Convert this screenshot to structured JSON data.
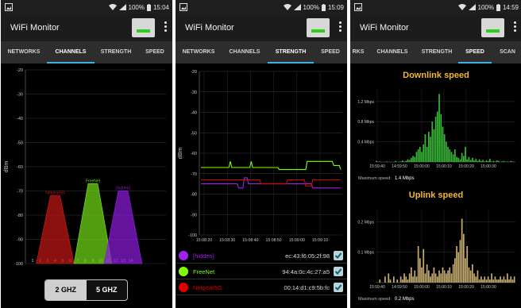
{
  "app": {
    "title": "WiFi Monitor"
  },
  "screens": [
    {
      "status_battery": "100%",
      "status_time": "15:04",
      "tabs": [
        "NETWORKS",
        "CHANNELS",
        "STRENGTH",
        "SPEED"
      ],
      "active_tab": "CHANNELS",
      "band_toggle": {
        "left": "2 GHZ",
        "right": "5 GHZ",
        "selected": "2 GHZ"
      }
    },
    {
      "status_battery": "100%",
      "status_time": "15:09",
      "tabs": [
        "NETWORKS",
        "CHANNELS",
        "STRENGTH",
        "SPEED"
      ],
      "active_tab": "STRENGTH",
      "networks": [
        {
          "ssid": "[hidden]",
          "mac": "ec:43:f6:05:2f:98",
          "color": "#a020f0",
          "checked": true
        },
        {
          "ssid": "FreeNet",
          "mac": "94:4a:0c:4c:27:a5",
          "color": "#7fff00",
          "checked": true
        },
        {
          "ssid": "Netgear5G",
          "mac": "00:14:d1:c9:5b:fc",
          "color": "#e00000",
          "checked": true
        }
      ]
    },
    {
      "status_battery": "100%",
      "status_time": "14:59",
      "tabs": [
        "RKS",
        "CHANNELS",
        "STRENGTH",
        "SPEED",
        "SCAN"
      ],
      "active_tab": "SPEED",
      "downlink": {
        "title": "Downlink speed",
        "max_label": "Maximum speed:",
        "max_value": "1.4 Mbps"
      },
      "uplink": {
        "title": "Uplink speed",
        "max_label": "Maximum speed:",
        "max_value": "0.2 Mbps"
      }
    }
  ],
  "chart_data": [
    {
      "type": "area",
      "chart": "channels",
      "ylabel": "dBm",
      "ylim": [
        -100,
        -20
      ],
      "yticks": [
        -20,
        -30,
        -40,
        -50,
        -60,
        -70,
        -80,
        -90,
        -100
      ],
      "xticks": [
        1,
        2,
        3,
        4,
        5,
        6,
        7,
        8,
        9,
        10,
        11,
        12,
        13,
        14
      ],
      "grid": true,
      "series": [
        {
          "name": "Netgear5G",
          "channel": 4,
          "level": -72,
          "color": "#c01818"
        },
        {
          "name": "FreeNet",
          "channel": 9,
          "level": -67,
          "color": "#70d818"
        },
        {
          "name": "[hidden]",
          "channel": 13,
          "level": -70,
          "color": "#8a1ad8"
        }
      ]
    },
    {
      "type": "line",
      "chart": "strength",
      "ylabel": "dBm",
      "ylim": [
        -100,
        -20
      ],
      "yticks": [
        -20,
        -30,
        -40,
        -50,
        -60,
        -70,
        -80,
        -90,
        -100
      ],
      "xtick_labels": [
        "15:08:20",
        "15:08:30",
        "15:08:40",
        "15:08:50",
        "15:09:00",
        "15:09:10"
      ],
      "grid": true,
      "series": [
        {
          "name": "FreeNet",
          "color": "#7fff00",
          "values": [
            -67,
            -67,
            -67,
            -67,
            -67,
            -67,
            -67,
            -67,
            -67,
            -67,
            -67,
            -67,
            -67,
            -67,
            -67,
            -67,
            -67,
            -67,
            -67,
            -67,
            -67,
            -64,
            -67,
            -67,
            -67,
            -67,
            -67,
            -67,
            -67,
            -67,
            -67,
            -67,
            -67,
            -67,
            -67,
            -67,
            -64,
            -67,
            -67,
            -67,
            -67,
            -67,
            -67,
            -67,
            -67,
            -67,
            -67,
            -67,
            -67,
            -67,
            -67,
            -67,
            -67,
            -67,
            -67,
            -67,
            -68,
            -68,
            -68,
            -68,
            -68,
            -68,
            -68,
            -68,
            -68,
            -68,
            -68,
            -68,
            -68,
            -68,
            -68,
            -68,
            -68,
            -68,
            -68,
            -68,
            -64,
            -64,
            -64,
            -64,
            -64,
            -64,
            -64,
            -64,
            -64,
            -64,
            -64,
            -64,
            -64,
            -64,
            -64,
            -64,
            -64,
            -64,
            -64,
            -66,
            -66,
            -66,
            -66,
            -66,
            -68
          ]
        },
        {
          "name": "[hidden]",
          "color": "#a020f0",
          "values": [
            -75,
            -75,
            -75,
            -75,
            -75,
            -75,
            -75,
            -75,
            -75,
            -75,
            -75,
            -75,
            -75,
            -75,
            -75,
            -75,
            -75,
            -75,
            -75,
            -75,
            -75,
            -75,
            -75,
            -75,
            -75,
            -75,
            -75,
            -77,
            -77,
            -77,
            -77,
            -72,
            -72,
            -72,
            -75,
            -75,
            -75,
            -75,
            -75,
            -75,
            -75,
            -75,
            -75,
            -75,
            -75,
            -75,
            -75,
            -75,
            -75,
            -75,
            -75,
            -75,
            -75,
            -75,
            -75,
            -75,
            -75,
            -75,
            -75,
            -75,
            -75,
            -75,
            -75,
            -75,
            -75,
            -75,
            -75,
            -75,
            -75,
            -75,
            -75,
            -75,
            -75,
            -75,
            -75,
            -75,
            -75,
            -75,
            -75,
            -75,
            -77,
            -77,
            -77,
            -77,
            -77,
            -77,
            -77,
            -77,
            -77,
            -77,
            -77,
            -77,
            -77,
            -77,
            -77,
            -77,
            -77,
            -77,
            -77,
            -77,
            -77
          ]
        },
        {
          "name": "Netgear5G",
          "color": "#e00000",
          "values": [
            -73,
            -73,
            -73,
            -73,
            -73,
            -73,
            -73,
            -73,
            -73,
            -73,
            -73,
            -73,
            -73,
            -73,
            -73,
            -73,
            -73,
            -73,
            -73,
            -73,
            -73,
            -73,
            -73,
            -73,
            -73,
            -73,
            -73,
            -73,
            -73,
            -73,
            -73,
            -73,
            -73,
            -73,
            -73,
            -73,
            -73,
            -73,
            -73,
            -73,
            -73,
            -73,
            -73,
            -75,
            -75,
            -75,
            -75,
            -75,
            -75,
            -75,
            -75,
            -75,
            -75,
            -75,
            -75,
            -75,
            -75,
            -75,
            -75,
            -75,
            -75,
            -75,
            -73,
            -73,
            -73,
            -73,
            -73,
            -73,
            -73,
            -73,
            -73,
            -73,
            -73,
            -73,
            -73,
            -76,
            -76,
            -76,
            -76,
            -76,
            -73,
            -73,
            -73,
            -73,
            -73,
            -73,
            -73,
            -73,
            -73,
            -73,
            -73,
            -73,
            -73,
            -73,
            -73,
            -73,
            -73,
            -73,
            -73,
            -73,
            -73
          ]
        }
      ]
    },
    {
      "type": "bar",
      "chart": "downlink",
      "title": "Downlink speed",
      "yticks": [
        0.4,
        0.8,
        1.2
      ],
      "ytick_labels": [
        "0.4 Mbps",
        "0.8 Mbps",
        "1.2 Mbps"
      ],
      "ylim": [
        0,
        1.45
      ],
      "xtick_labels": [
        "15:59:40",
        "14:59:50",
        "15:00:00",
        "15:00:10",
        "15:00:20",
        "15:00:30"
      ],
      "color": "#37b837",
      "values": [
        0.02,
        0,
        0.01,
        0,
        0,
        0,
        0.01,
        0,
        0,
        0,
        0,
        0.02,
        0,
        0,
        0.01,
        0.03,
        0.01,
        0.02,
        0.05,
        0.04,
        0.08,
        0.12,
        0.1,
        0.2,
        0.25,
        0.3,
        0.2,
        0.35,
        0.55,
        0.3,
        0.6,
        0.5,
        0.8,
        0.65,
        0.9,
        1.0,
        1.35,
        0.95,
        0.7,
        0.55,
        0.4,
        0.3,
        0.25,
        0.2,
        0.15,
        0.25,
        0.1,
        0.08,
        0.05,
        0.18,
        0.12,
        0.3,
        0.05,
        0.1,
        0.04,
        0.08,
        0.03,
        0.06,
        0.02,
        0.05,
        0.02,
        0.04,
        0.01,
        0.03,
        0.02,
        0.06,
        0.01,
        0.02,
        0.01,
        0.03,
        0.02,
        0,
        0.01,
        0.02,
        0,
        0.01,
        0,
        0.02,
        0.01,
        0
      ]
    },
    {
      "type": "bar",
      "chart": "uplink",
      "title": "Uplink speed",
      "yticks": [
        0.1,
        0.2
      ],
      "ytick_labels": [
        "0.1 Mbps",
        "0.2 Mbps"
      ],
      "ylim": [
        0,
        0.24
      ],
      "xtick_labels": [
        "15:59:40",
        "14:59:50",
        "15:00:00",
        "15:00:10",
        "15:00:20",
        "15:00:30"
      ],
      "color": "#c8ad72",
      "values": [
        0,
        0,
        0.01,
        0,
        0,
        0.02,
        0,
        0.03,
        0.01,
        0,
        0.02,
        0,
        0.01,
        0,
        0.02,
        0.01,
        0.03,
        0.02,
        0.01,
        0.03,
        0.05,
        0.02,
        0.04,
        0.02,
        0.12,
        0.08,
        0.05,
        0.11,
        0.03,
        0.06,
        0.04,
        0.02,
        0.03,
        0.05,
        0.03,
        0.02,
        0.04,
        0.03,
        0.05,
        0.04,
        0.03,
        0.04,
        0.05,
        0.03,
        0.06,
        0.08,
        0.12,
        0.1,
        0.14,
        0.21,
        0.16,
        0.08,
        0.12,
        0.05,
        0.04,
        0.06,
        0.03,
        0.02,
        0.04,
        0.01,
        0.02,
        0.01,
        0.02,
        0.01,
        0.02,
        0.01,
        0.03,
        0.01,
        0.02,
        0.01,
        0.01,
        0.02,
        0.01,
        0.02,
        0.01,
        0.03,
        0.01,
        0.02,
        0.01,
        0.02
      ]
    }
  ]
}
